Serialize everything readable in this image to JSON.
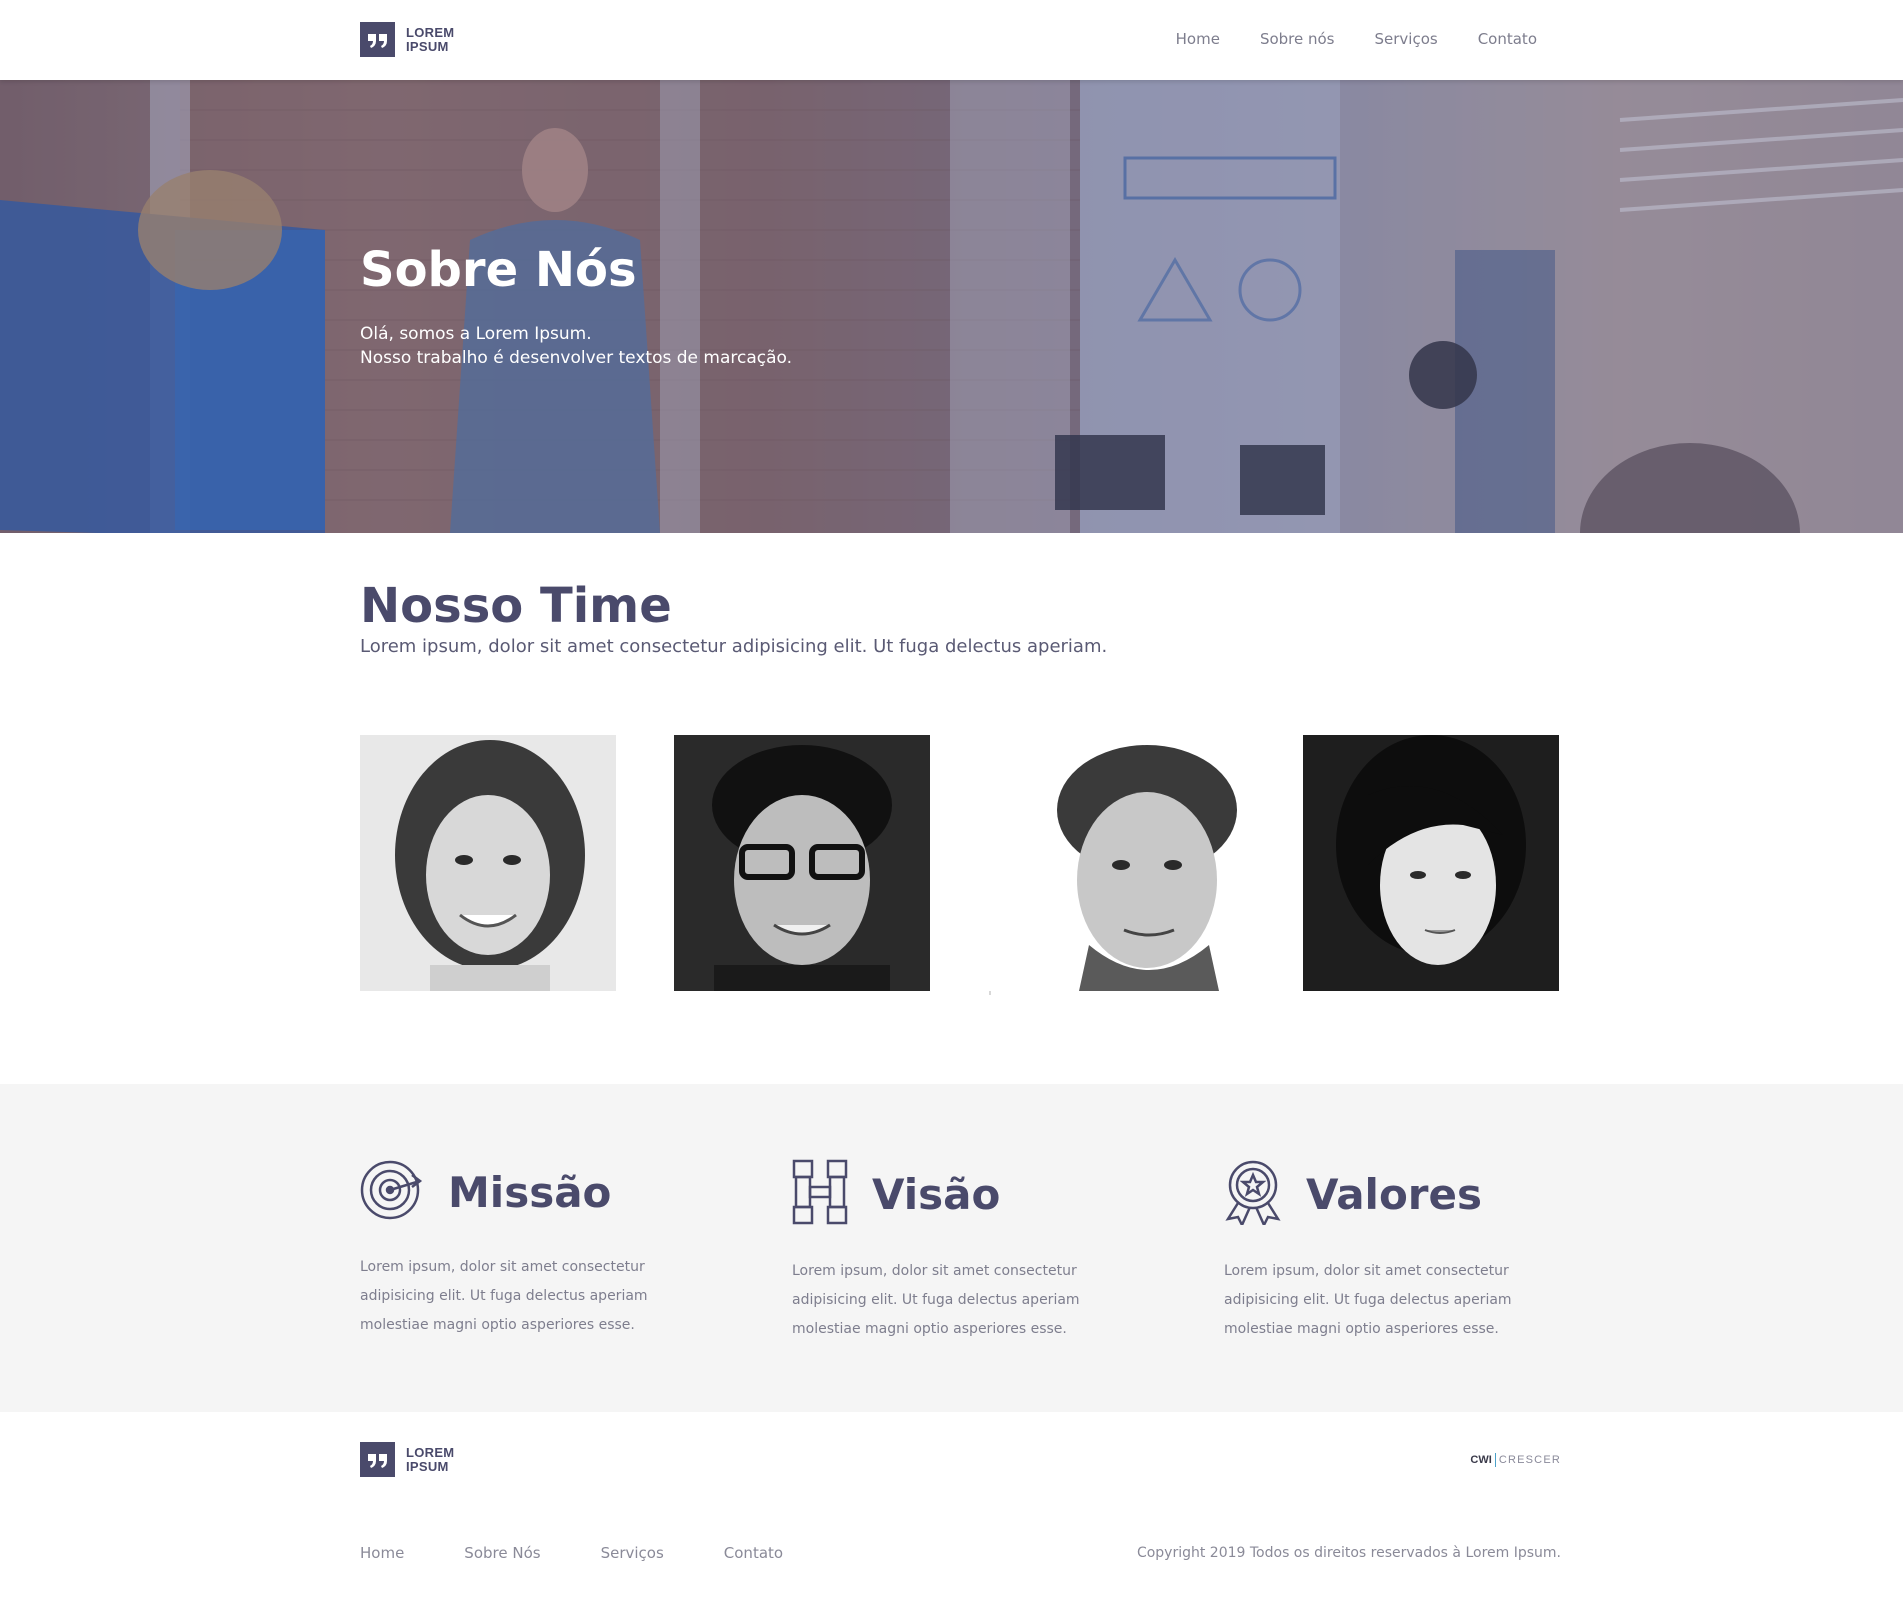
{
  "header": {
    "logo": {
      "line1": "LOREM",
      "line2": "IPSUM"
    },
    "nav": [
      "Home",
      "Sobre nós",
      "Serviços",
      "Contato"
    ]
  },
  "hero": {
    "title": "Sobre Nós",
    "subtitle_line1": "Olá, somos a Lorem Ipsum.",
    "subtitle_line2": "Nosso trabalho é desenvolver textos de marcação."
  },
  "team": {
    "title": "Nosso Time",
    "subtitle": "Lorem ipsum, dolor sit amet consectetur adipisicing elit. Ut fuga delectus aperiam."
  },
  "mvv": [
    {
      "icon": "target-icon",
      "title": "Missão",
      "text": "Lorem ipsum, dolor sit amet consectetur adipisicing elit. Ut fuga delectus aperiam molestiae magni optio asperiores esse."
    },
    {
      "icon": "binoculars-icon",
      "title": "Visão",
      "text": "Lorem ipsum, dolor sit amet consectetur adipisicing elit. Ut fuga delectus aperiam molestiae magni optio asperiores esse."
    },
    {
      "icon": "award-badge-icon",
      "title": "Valores",
      "text": "Lorem ipsum, dolor sit amet consectetur adipisicing elit. Ut fuga delectus aperiam molestiae magni optio asperiores esse."
    }
  ],
  "footer": {
    "logo": {
      "line1": "LOREM",
      "line2": "IPSUM"
    },
    "brand": {
      "part1": "CWI",
      "part2": "CRESCER"
    },
    "nav": [
      "Home",
      "Sobre Nós",
      "Serviços",
      "Contato"
    ],
    "copyright": "Copyright 2019 Todos os direitos reservados à Lorem Ipsum."
  },
  "colors": {
    "primary": "#4a4a6b",
    "muted": "#7e7e8e",
    "section_bg": "#f5f5f5"
  }
}
